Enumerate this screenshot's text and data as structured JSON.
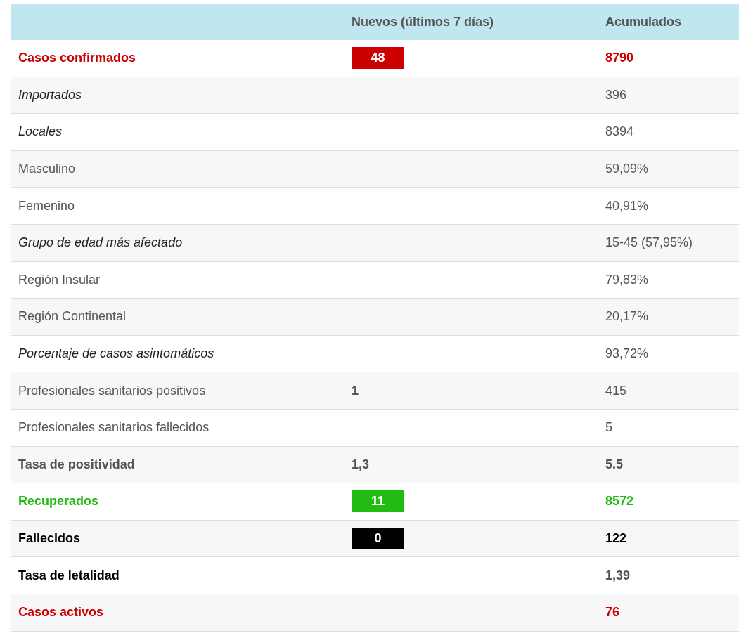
{
  "table": {
    "columns": [
      "",
      "Nuevos (últimos 7 días)",
      "Acumulados"
    ],
    "rows": [
      {
        "label": "Casos confirmados",
        "kind": "bold",
        "color": "#cc0000",
        "new": {
          "text": "48",
          "badge": true
        },
        "total": "8790"
      },
      {
        "label": "Importados",
        "kind": "italic",
        "total": "396"
      },
      {
        "label": "Locales",
        "kind": "italic",
        "total": "8394"
      },
      {
        "label": "Masculino",
        "kind": "plain",
        "total": "59,09%"
      },
      {
        "label": "Femenino",
        "kind": "plain",
        "total": "40,91%"
      },
      {
        "label": "Grupo de edad más afectado",
        "kind": "italic",
        "total": "15-45 (57,95%)"
      },
      {
        "label": "Región Insular",
        "kind": "plain",
        "total": "79,83%"
      },
      {
        "label": "Región Continental",
        "kind": "plain",
        "total": "20,17%"
      },
      {
        "label": "Porcentaje de casos asintomáticos",
        "kind": "italic",
        "total": "93,72%"
      },
      {
        "label": "Profesionales sanitarios positivos",
        "kind": "plain",
        "new": {
          "text": "1",
          "badge": false
        },
        "total": "415"
      },
      {
        "label": "Profesionales sanitarios fallecidos",
        "kind": "plain",
        "total": "5"
      },
      {
        "label": "Tasa de positividad",
        "kind": "bold",
        "new": {
          "text": "1,3",
          "badge": false
        },
        "total": "5.5"
      },
      {
        "label": "Recuperados",
        "kind": "bold",
        "color": "#22bb11",
        "new": {
          "text": "11",
          "badge": true
        },
        "total": "8572"
      },
      {
        "label": "Fallecidos",
        "kind": "bold",
        "color": "#000000",
        "new": {
          "text": "0",
          "badge": true
        },
        "total": "122",
        "total_muted": false
      },
      {
        "label": "Tasa de letalidad",
        "kind": "bold",
        "color": "#000000",
        "total": "1,39",
        "total_muted": true
      },
      {
        "label": "Casos activos",
        "kind": "bold",
        "color": "#cc0000",
        "total": "76"
      }
    ]
  }
}
